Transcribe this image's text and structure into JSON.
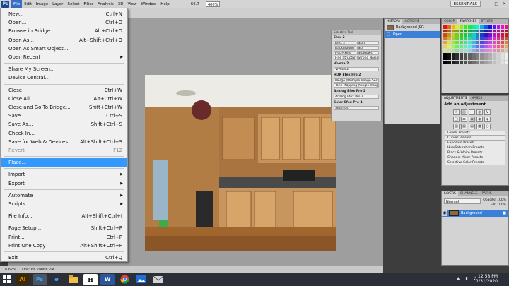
{
  "menubar": {
    "logo": "Ps",
    "items": [
      "File",
      "Edit",
      "Image",
      "Layer",
      "Select",
      "Filter",
      "Analysis",
      "3D",
      "View",
      "Window",
      "Help"
    ],
    "zoom": "66.7",
    "zoom_box": "400%",
    "workspace": "ESSENTIALS"
  },
  "file_menu": {
    "items": [
      {
        "label": "New...",
        "shortcut": "Ctrl+N"
      },
      {
        "label": "Open...",
        "shortcut": "Ctrl+O"
      },
      {
        "label": "Browse in Bridge...",
        "shortcut": "Alt+Ctrl+O"
      },
      {
        "label": "Open As...",
        "shortcut": "Alt+Shift+Ctrl+O"
      },
      {
        "label": "Open As Smart Object...",
        "shortcut": ""
      },
      {
        "label": "Open Recent",
        "shortcut": "",
        "submenu": true
      },
      {
        "label": "Share My Screen...",
        "shortcut": ""
      },
      {
        "label": "Device Central...",
        "shortcut": ""
      },
      {
        "label": "Close",
        "shortcut": "Ctrl+W"
      },
      {
        "label": "Close All",
        "shortcut": "Alt+Ctrl+W"
      },
      {
        "label": "Close and Go To Bridge...",
        "shortcut": "Shift+Ctrl+W"
      },
      {
        "label": "Save",
        "shortcut": "Ctrl+S"
      },
      {
        "label": "Save As...",
        "shortcut": "Shift+Ctrl+S"
      },
      {
        "label": "Check In...",
        "shortcut": ""
      },
      {
        "label": "Save for Web & Devices...",
        "shortcut": "Alt+Shift+Ctrl+S"
      },
      {
        "label": "Revert",
        "shortcut": "F12",
        "disabled": true
      },
      {
        "label": "Place...",
        "shortcut": "",
        "highlighted": true
      },
      {
        "label": "Import",
        "shortcut": "",
        "submenu": true
      },
      {
        "label": "Export",
        "shortcut": "",
        "submenu": true
      },
      {
        "label": "Automate",
        "shortcut": "",
        "submenu": true
      },
      {
        "label": "Scripts",
        "shortcut": "",
        "submenu": true
      },
      {
        "label": "File Info...",
        "shortcut": "Alt+Shift+Ctrl+I"
      },
      {
        "label": "Page Setup...",
        "shortcut": "Shift+Ctrl+P"
      },
      {
        "label": "Print...",
        "shortcut": "Ctrl+P"
      },
      {
        "label": "Print One Copy",
        "shortcut": "Alt+Shift+Ctrl+P"
      },
      {
        "label": "Exit",
        "shortcut": "Ctrl+Q"
      }
    ]
  },
  "status": {
    "zoom": "16.67%",
    "doc": "Doc: 66.7M/66.7M"
  },
  "nik_panel": {
    "title": "Selective Tool",
    "section1": "Efex 2",
    "cells": [
      "Efex 2",
      "Skin",
      "Background",
      "Sky",
      "Hot Pixels",
      "Shadows",
      "Fine Structure",
      "Strong Noise"
    ],
    "section2": "Viveza 2",
    "btn2": "Viveza 2",
    "section3": "HDR Efex Pro 2",
    "btn3a": "Merge (Multiple Image Series)",
    "btn3b": "Tone Mapping (Single Image)",
    "section4": "Analog Efex Pro 2",
    "btn4": "Analog Efex Pro 2",
    "section5": "Color Efex Pro 4",
    "settings": "Settings"
  },
  "history": {
    "tabs": [
      "HISTORY",
      "ACTIONS"
    ],
    "rows": [
      {
        "label": "Background.JPG"
      },
      {
        "label": "Open"
      }
    ]
  },
  "swatches": {
    "tabs": [
      "COLOR",
      "SWATCHES",
      "STYLES"
    ]
  },
  "adjustments": {
    "tabs": [
      "ADJUSTMENTS",
      "MASKS"
    ],
    "heading": "Add an adjustment",
    "presets": [
      "Levels Presets",
      "Curves Presets",
      "Exposure Presets",
      "Hue/Saturation Presets",
      "Black & White Presets",
      "Channel Mixer Presets",
      "Selective Color Presets"
    ]
  },
  "layers": {
    "tabs": [
      "LAYERS",
      "CHANNELS",
      "PATHS"
    ],
    "blend": "Normal",
    "opacity": "Opacity: 100%",
    "fill": "Fill: 100%",
    "layer_name": "Background"
  },
  "taskbar": {
    "apps": [
      "Ai",
      "Ps",
      "e",
      "",
      "H",
      "W",
      ""
    ],
    "time": "12:58 PM",
    "date": "1/31/2020"
  }
}
